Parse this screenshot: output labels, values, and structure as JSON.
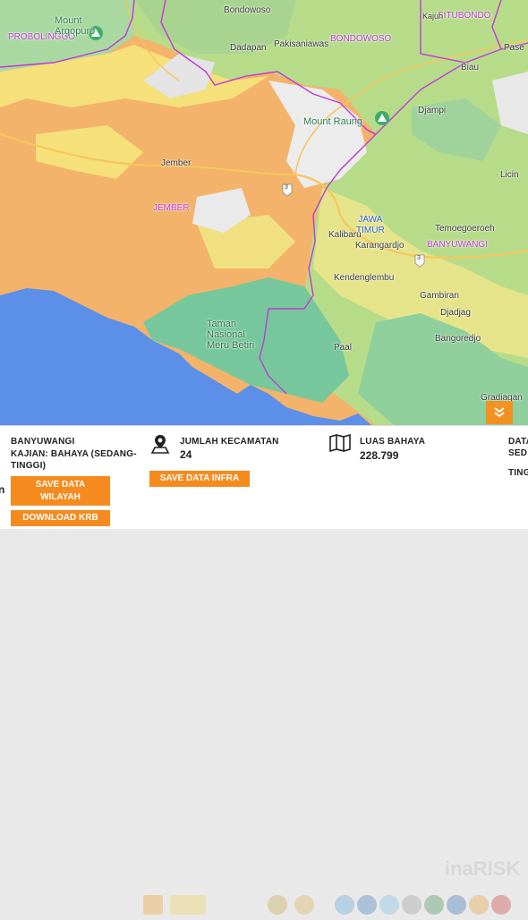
{
  "map": {
    "labels": {
      "probolinggo": "PROBOLINGGO",
      "mount_argopuro": "Mount\nArgopuro",
      "bondowoso_town": "Bondowoso",
      "bondowoso_region": "BONDOWOSO",
      "situbondo": "SITUBONDO",
      "kajuh": "Kajuh",
      "dadapan": "Dadapan",
      "pakisaniawas": "Pakisaniawas",
      "biau": "Biau",
      "pase": "Pase",
      "djampi": "Djampi",
      "mount_raung": "Mount Raung",
      "jember_town": "Jember",
      "jember_region": "JEMBER",
      "licin": "Licin",
      "jawa_timur": "JAWA\nTIMUR",
      "kalibaru": "Kalibaru",
      "temoegoeroeh": "Temoegoeroeh",
      "karangardjo": "Karangardjo",
      "banyuwangi_region": "BANYUWANGI",
      "kendenglembu": "Kendenglembu",
      "gambiran": "Gambiran",
      "djadjag": "Djadjag",
      "taman_nasional": "Taman\nNasional\nMeru Betiri",
      "paal": "Paal",
      "bangoredjo": "Bangoredjo",
      "gradiagan": "Gradiagan",
      "road_shield": "3"
    },
    "colors": {
      "sea": "#5b8fe8",
      "high_hazard": "#f3b36a",
      "medium_hazard": "#f5e07a",
      "low_hazard": "#b6dc8a",
      "forest": "#76c89c",
      "boundary": "#c03ad6"
    }
  },
  "panel": {
    "collapse_icon": "double-chevron-down-icon",
    "region_name": "BANYUWANGI",
    "kajian_line1": "KAJIAN: BAHAYA (SEDANG-",
    "kajian_line2": "TINGGI)",
    "save_wilayah": "SAVE DATA\nWILAYAH",
    "download_krb": "DOWNLOAD KRB",
    "kecamatan_label": "JUMLAH KECAMATAN",
    "kecamatan_value": "24",
    "save_infra": "SAVE DATA INFRA",
    "luas_label": "LUAS BAHAYA",
    "luas_value": "228.799",
    "data_label_line1": "DATA",
    "data_label_line2": "SED",
    "data_label_line3": "TING",
    "watermark": "inaRISK",
    "left_edge_char": "n"
  }
}
